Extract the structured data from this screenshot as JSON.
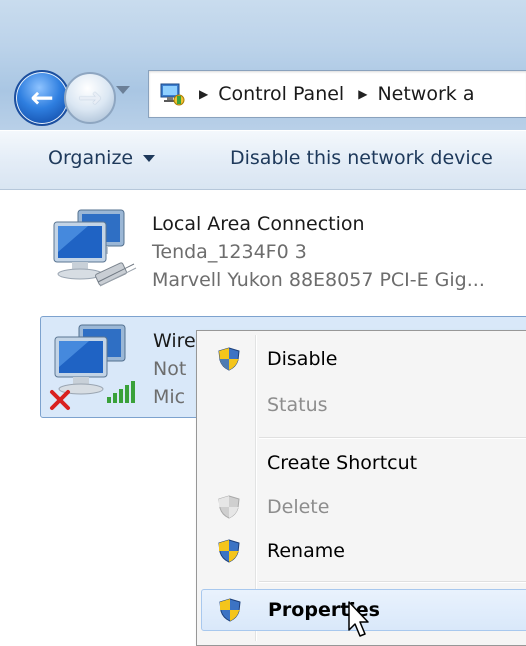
{
  "address": {
    "crumbs": [
      "Control Panel",
      "Network a"
    ],
    "icon": "control-panel-icon"
  },
  "toolbar": {
    "organize_label": "Organize",
    "disable_label": "Disable this network device"
  },
  "connections": [
    {
      "name": "Local Area Connection",
      "network": "Tenda_1234F0  3",
      "adapter": "Marvell Yukon 88E8057 PCI-E Gig...",
      "icon": "wired-network-icon"
    },
    {
      "name": "Wire",
      "network": "Not",
      "adapter": "Mic",
      "icon": "wireless-network-icon",
      "status_icon": "disconnected-x-icon"
    }
  ],
  "context_menu": {
    "items": [
      {
        "label": "Disable",
        "icon": "uac-shield-icon",
        "enabled": true
      },
      {
        "label": "Status",
        "enabled": false
      },
      {
        "label": "Create Shortcut",
        "enabled": true
      },
      {
        "label": "Delete",
        "icon": "uac-shield-icon",
        "enabled": false
      },
      {
        "label": "Rename",
        "icon": "uac-shield-icon",
        "enabled": true
      },
      {
        "label": "Properties",
        "icon": "uac-shield-icon",
        "enabled": true,
        "highlighted": true,
        "default": true
      }
    ]
  },
  "colors": {
    "selection_bg": "#d9e8f9",
    "command_text": "#1e395b",
    "disabled_text": "#8d8d8d"
  }
}
